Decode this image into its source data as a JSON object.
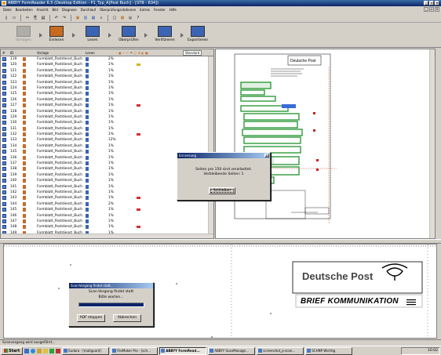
{
  "window": {
    "title": "ABBYY FormReader 6.5 (Desktop Edition - P1_Typ_A[Post Buch] - [STB - 834])"
  },
  "menu": {
    "items": [
      "Datei",
      "Bearbeiten",
      "Ansicht",
      "Bild",
      "Diagnose",
      "Durchlauf",
      "Überprüfungsstationen",
      "Extras",
      "Fenster",
      "Hilfe"
    ]
  },
  "toolbar": {
    "big": [
      {
        "label": "Vorlagen",
        "disabled": true
      },
      {
        "label": "Einlesen",
        "disabled": false
      },
      {
        "label": "Lesen",
        "disabled": false
      },
      {
        "label": "Überprüfen",
        "disabled": false
      },
      {
        "label": "Verifizieren",
        "disabled": false
      },
      {
        "label": "Exportieren",
        "disabled": false
      }
    ]
  },
  "list": {
    "headers": {
      "num": "#",
      "id": "ID",
      "template": "Vorlage",
      "scan": "Lesen",
      "dropdown": "Standard"
    },
    "rows": [
      {
        "num": "119",
        "name": "Formblatt_Postdienst_Buch",
        "pct": "2%",
        "flag": ""
      },
      {
        "num": "120",
        "name": "Formblatt_Postdienst_Buch",
        "pct": "1%",
        "flag": "yellow"
      },
      {
        "num": "121",
        "name": "Formblatt_Postdienst_Buch",
        "pct": "1%",
        "flag": ""
      },
      {
        "num": "122",
        "name": "Formblatt_Postdienst_Buch",
        "pct": "1%",
        "flag": ""
      },
      {
        "num": "123",
        "name": "Formblatt_Postdienst_Buch",
        "pct": "1%",
        "flag": ""
      },
      {
        "num": "124",
        "name": "Formblatt_Postdienst_Buch",
        "pct": "1%",
        "flag": ""
      },
      {
        "num": "125",
        "name": "Formblatt_Postdienst_Buch",
        "pct": "1%",
        "flag": ""
      },
      {
        "num": "126",
        "name": "Formblatt_Postdienst_Buch",
        "pct": "1%",
        "flag": ""
      },
      {
        "num": "127",
        "name": "Formblatt_Postdienst_Buch",
        "pct": "1%",
        "flag": "red"
      },
      {
        "num": "128",
        "name": "Formblatt_Postdienst_Buch",
        "pct": "1%",
        "flag": ""
      },
      {
        "num": "129",
        "name": "Formblatt_Postdienst_Buch",
        "pct": "1%",
        "flag": ""
      },
      {
        "num": "130",
        "name": "Formblatt_Postdienst_Buch",
        "pct": "1%",
        "flag": ""
      },
      {
        "num": "131",
        "name": "Formblatt_Postdienst_Buch",
        "pct": "1%",
        "flag": ""
      },
      {
        "num": "132",
        "name": "Formblatt_Postdienst_Buch",
        "pct": "1%",
        "flag": "red"
      },
      {
        "num": "133",
        "name": "Formblatt_Postdienst_Buch",
        "pct": "12%",
        "flag": ""
      },
      {
        "num": "134",
        "name": "Formblatt_Postdienst_Buch",
        "pct": "1%",
        "flag": ""
      },
      {
        "num": "135",
        "name": "Formblatt_Postdienst_Buch",
        "pct": "1%",
        "flag": ""
      },
      {
        "num": "136",
        "name": "Formblatt_Postdienst_Buch",
        "pct": "1%",
        "flag": ""
      },
      {
        "num": "137",
        "name": "Formblatt_Postdienst_Buch",
        "pct": "1%",
        "flag": ""
      },
      {
        "num": "138",
        "name": "Formblatt_Postdienst_Buch",
        "pct": "1%",
        "flag": ""
      },
      {
        "num": "139",
        "name": "Formblatt_Postdienst_Buch",
        "pct": "1%",
        "flag": ""
      },
      {
        "num": "140",
        "name": "Formblatt_Postdienst_Buch",
        "pct": "1%",
        "flag": ""
      },
      {
        "num": "141",
        "name": "Formblatt_Postdienst_Buch",
        "pct": "1%",
        "flag": ""
      },
      {
        "num": "142",
        "name": "Formblatt_Postdienst_Buch",
        "pct": "1%",
        "flag": ""
      },
      {
        "num": "143",
        "name": "Formblatt_Postdienst_Buch",
        "pct": "1%",
        "flag": "red"
      },
      {
        "num": "144",
        "name": "Formblatt_Postdienst_Buch",
        "pct": "2%",
        "flag": ""
      },
      {
        "num": "145",
        "name": "Formblatt_Postdienst_Buch",
        "pct": "1%",
        "flag": "red"
      },
      {
        "num": "146",
        "name": "Formblatt_Postdienst_Buch",
        "pct": "1%",
        "flag": ""
      },
      {
        "num": "147",
        "name": "Formblatt_Postdienst_Buch",
        "pct": "1%",
        "flag": ""
      },
      {
        "num": "148",
        "name": "Formblatt_Postdienst_Buch",
        "pct": "1%",
        "flag": "red"
      },
      {
        "num": "149",
        "name": "Formblatt_Postdienst_Buch",
        "pct": "1%",
        "flag": ""
      }
    ]
  },
  "preview": {
    "logo_text": "Deutsche Post",
    "fields": [
      "",
      ""
    ]
  },
  "reminder_dialog": {
    "title": "Erinnerung",
    "line1": "Seiten pro 150 sind verarbeitet.",
    "line2": "Verbleibende Seiten: 1",
    "ok_label": "Schließen"
  },
  "scan_dialog": {
    "title": "Scan-Vorgang findet statt...",
    "line1": "Scan-Vorgang findet statt",
    "line2": "Bitte warten...",
    "progress": 1.0,
    "adf_label": "ADF stoppen",
    "cancel_label": "Abbrechen"
  },
  "bottom": {
    "brand": "Deutsche Post",
    "tagline": "BRIEF KOMMUNIKATION"
  },
  "status": {
    "text": "Scanvorgang wird ausgeführt..."
  },
  "taskbar": {
    "start": "Start",
    "tasks": [
      {
        "label": "Eudora - [mailguard]",
        "active": false
      },
      {
        "label": "FileMaker Pro - [sch...",
        "active": false
      },
      {
        "label": "ABBYY FormRead...",
        "active": true
      },
      {
        "label": "ABBYY ScanManage...",
        "active": false
      },
      {
        "label": "screenshot_p-scan...",
        "active": false
      },
      {
        "label": "SCHNP Wichtig",
        "active": false
      }
    ],
    "clock": "10:02"
  },
  "colors": {
    "titlebar": "#0a246a",
    "field_green": "#2f9a3a",
    "progress": "#0a246a"
  }
}
